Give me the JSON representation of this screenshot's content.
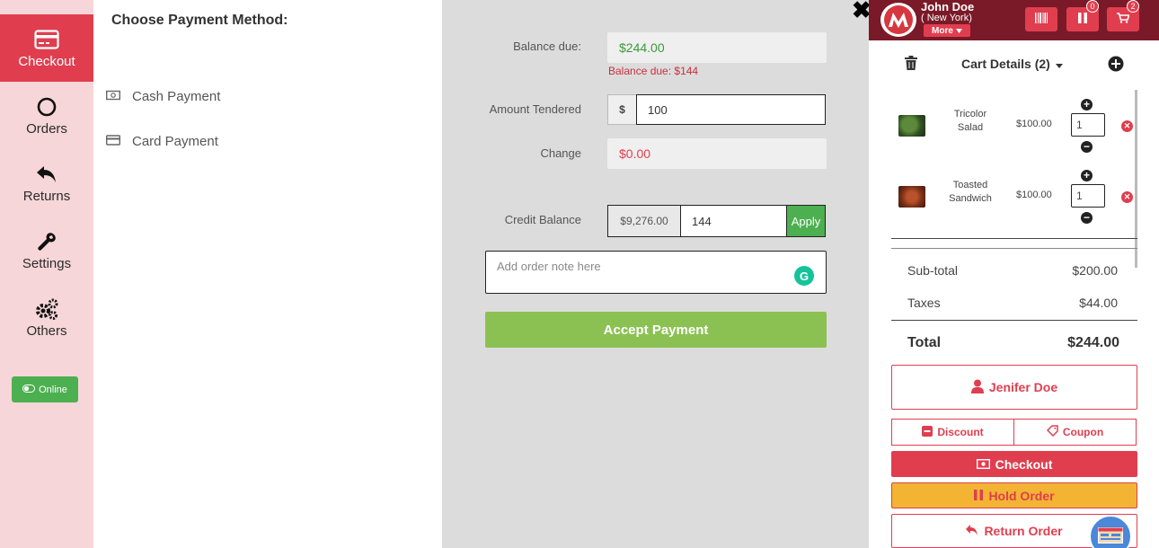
{
  "sidebar": {
    "items": [
      {
        "label": "Checkout",
        "icon": "credit-card-icon"
      },
      {
        "label": "Orders",
        "icon": "circle-icon"
      },
      {
        "label": "Returns",
        "icon": "reply-icon"
      },
      {
        "label": "Settings",
        "icon": "wrench-icon"
      },
      {
        "label": "Others",
        "icon": "gears-icon"
      }
    ],
    "online_label": "Online"
  },
  "payment_methods": {
    "title": "Choose Payment Method:",
    "items": [
      {
        "label": "Cash Payment",
        "icon": "money-icon"
      },
      {
        "label": "Card Payment",
        "icon": "card-icon"
      }
    ]
  },
  "payment_form": {
    "balance_due_label": "Balance due:",
    "balance_due_value": "$244.00",
    "balance_due_note": "Balance due: $144",
    "amount_tendered_label": "Amount Tendered",
    "currency_symbol": "$",
    "amount_tendered_value": "100",
    "change_label": "Change",
    "change_value": "$0.00",
    "credit_balance_label": "Credit Balance",
    "credit_balance_value": "$9,276.00",
    "credit_apply_value": "144",
    "apply_label": "Apply",
    "note_placeholder": "Add order note here",
    "grammarly_letter": "G",
    "accept_label": "Accept Payment",
    "close_glyph": "✖"
  },
  "header": {
    "user_name": "John Doe",
    "user_location": "( New York)",
    "more_label": "More",
    "hold_badge": "0",
    "cart_badge": "2"
  },
  "cart": {
    "title": "Cart Details (2)",
    "items": [
      {
        "name": "Tricolor Salad",
        "price": "$100.00",
        "qty": "1"
      },
      {
        "name": "Toasted Sandwich",
        "price": "$100.00",
        "qty": "1"
      }
    ],
    "subtotal_label": "Sub-total",
    "subtotal_value": "$200.00",
    "taxes_label": "Taxes",
    "taxes_value": "$44.00",
    "total_label": "Total",
    "total_value": "$244.00",
    "customer_label": "Jenifer Doe",
    "discount_label": "Discount",
    "coupon_label": "Coupon",
    "checkout_label": "Checkout",
    "hold_label": "Hold Order",
    "return_label": "Return Order"
  },
  "colors": {
    "brand_red": "#e03e4f",
    "header_maroon": "#7a1a28",
    "accept_green": "#8bc152",
    "online_green": "#4cb050",
    "hold_yellow": "#f3b434"
  }
}
